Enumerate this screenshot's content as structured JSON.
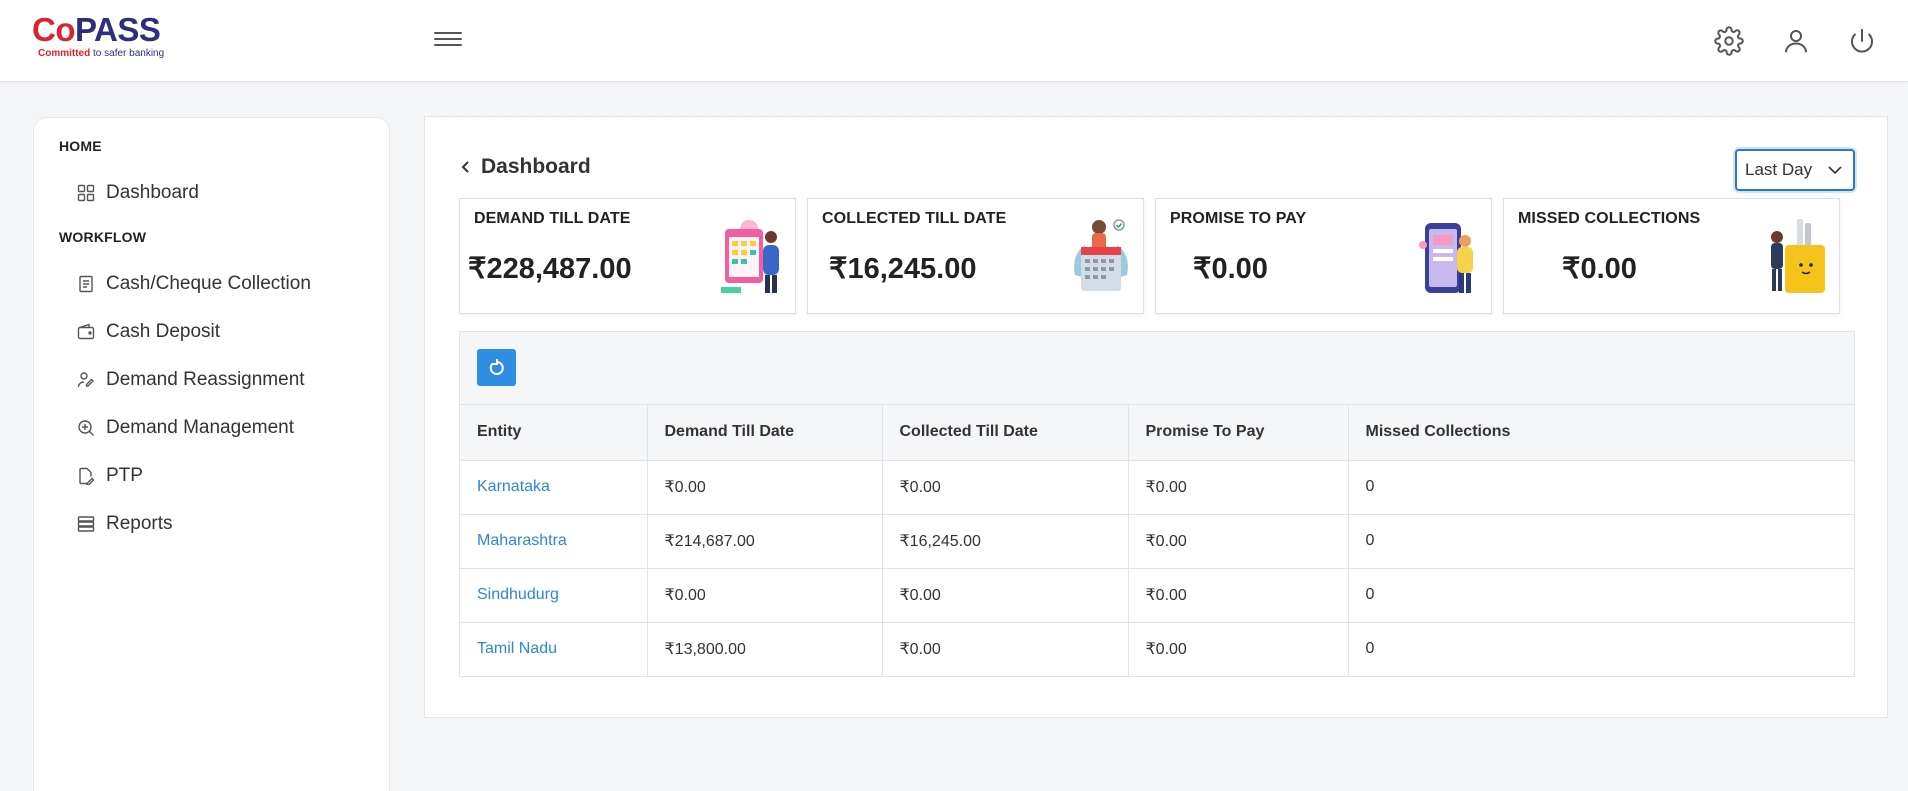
{
  "brand": {
    "co": "Co",
    "pass": "PASS",
    "tag_strong": "Committed",
    "tag_rest": " to safer banking"
  },
  "header": {
    "icons": [
      "hamburger-menu-icon",
      "settings-gear-icon",
      "user-profile-icon",
      "power-icon"
    ]
  },
  "sidebar": {
    "home_label": "HOME",
    "workflow_label": "WORKFLOW",
    "items": [
      {
        "label": "Dashboard",
        "icon": "grid-icon"
      },
      {
        "label": "Cash/Cheque Collection",
        "icon": "document-icon"
      },
      {
        "label": "Cash Deposit",
        "icon": "wallet-icon"
      },
      {
        "label": "Demand Reassignment",
        "icon": "user-edit-icon"
      },
      {
        "label": "Demand Management",
        "icon": "zoom-plus-icon"
      },
      {
        "label": "PTP",
        "icon": "pen-doc-icon"
      },
      {
        "label": "Reports",
        "icon": "stack-icon"
      }
    ]
  },
  "main": {
    "title": "Dashboard",
    "period_select": "Last Day",
    "cards": [
      {
        "title": "DEMAND TILL DATE",
        "value": "₹228,487.00"
      },
      {
        "title": "COLLECTED TILL DATE",
        "value": "₹16,245.00"
      },
      {
        "title": "PROMISE TO PAY",
        "value": "₹0.00"
      },
      {
        "title": "MISSED COLLECTIONS",
        "value": "₹0.00"
      }
    ],
    "table": {
      "headers": [
        "Entity",
        "Demand Till Date",
        "Collected Till Date",
        "Promise To Pay",
        "Missed Collections"
      ],
      "rows": [
        [
          "Karnataka",
          "₹0.00",
          "₹0.00",
          "₹0.00",
          "0"
        ],
        [
          "Maharashtra",
          "₹214,687.00",
          "₹16,245.00",
          "₹0.00",
          "0"
        ],
        [
          "Sindhudurg",
          "₹0.00",
          "₹0.00",
          "₹0.00",
          "0"
        ],
        [
          "Tamil Nadu",
          "₹13,800.00",
          "₹0.00",
          "₹0.00",
          "0"
        ]
      ]
    }
  },
  "colors": {
    "accent": "#2f8de4",
    "link": "#2f86d9",
    "brand_red": "#d9232e",
    "brand_navy": "#2b2f7e"
  }
}
